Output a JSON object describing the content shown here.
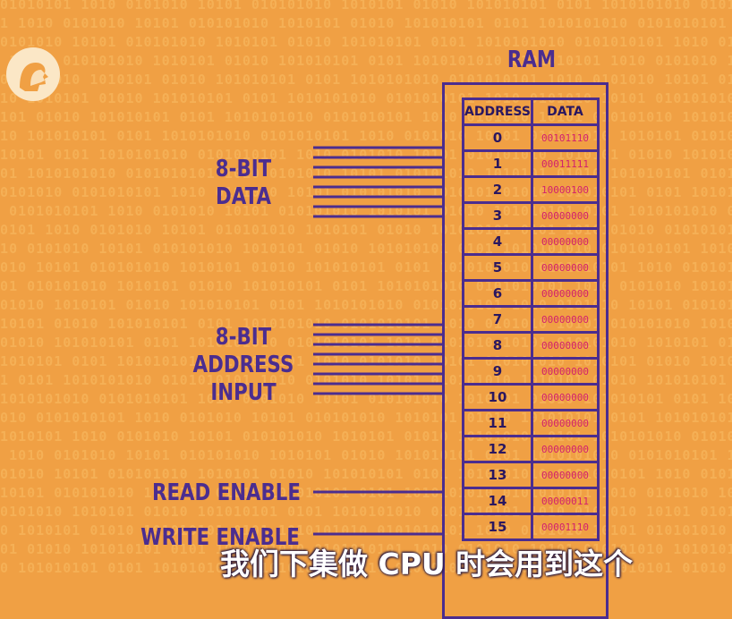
{
  "ram_title": "RAM",
  "data_label": [
    "8-BIT",
    "DATA"
  ],
  "address_label": [
    "8-BIT",
    "ADDRESS",
    "INPUT"
  ],
  "read_enable_label": "READ ENABLE",
  "write_enable_label": "WRITE ENABLE",
  "table": {
    "headers": [
      "ADDRESS",
      "DATA"
    ],
    "rows": [
      {
        "address": "0",
        "data": "00101110"
      },
      {
        "address": "1",
        "data": "00011111"
      },
      {
        "address": "2",
        "data": "10000100"
      },
      {
        "address": "3",
        "data": "00000000"
      },
      {
        "address": "4",
        "data": "00000000"
      },
      {
        "address": "5",
        "data": "00000000"
      },
      {
        "address": "6",
        "data": "00000000"
      },
      {
        "address": "7",
        "data": "00000000"
      },
      {
        "address": "8",
        "data": "00000000"
      },
      {
        "address": "9",
        "data": "00000000"
      },
      {
        "address": "10",
        "data": "00000000"
      },
      {
        "address": "11",
        "data": "00000000"
      },
      {
        "address": "12",
        "data": "00000000"
      },
      {
        "address": "13",
        "data": "00000000"
      },
      {
        "address": "14",
        "data": "00000011"
      },
      {
        "address": "15",
        "data": "00001110"
      }
    ]
  },
  "subtitle": "我们下集做 CPU 时会用到这个",
  "colors": {
    "background": "#f0a044",
    "ink": "#4b2d8f",
    "data_values": "#d2206e",
    "subtitle": "#ffffff"
  },
  "icons": {
    "logo": "pbs-logo-icon"
  }
}
